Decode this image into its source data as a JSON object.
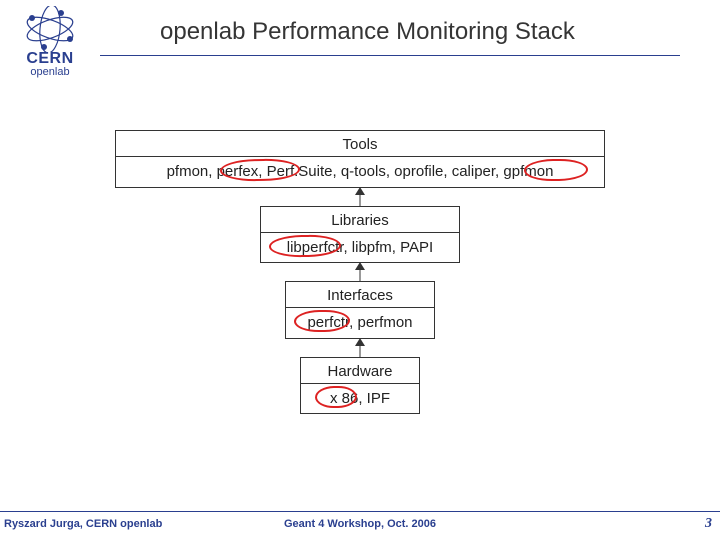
{
  "header": {
    "title": "openlab Performance Monitoring Stack",
    "logo_line1": "CERN",
    "logo_line2": "openlab"
  },
  "stack": {
    "layers": [
      {
        "title": "Tools",
        "items_text": "pfmon, perfex, Perf.Suite, q-tools, oprofile, caliper, gpfmon",
        "highlights": [
          "Perf.Suite",
          "gpfmon"
        ]
      },
      {
        "title": "Libraries",
        "items_text": "libperfctr, libpfm, PAPI",
        "highlights": [
          "libperfctr"
        ]
      },
      {
        "title": "Interfaces",
        "items_text": "perfctr, perfmon",
        "highlights": [
          "perfctr"
        ]
      },
      {
        "title": "Hardware",
        "items_text": "x 86, IPF",
        "highlights": [
          "x 86"
        ]
      }
    ]
  },
  "footer": {
    "left": "Ryszard Jurga, CERN openlab",
    "center": "Geant 4 Workshop, Oct. 2006",
    "right": "3"
  }
}
